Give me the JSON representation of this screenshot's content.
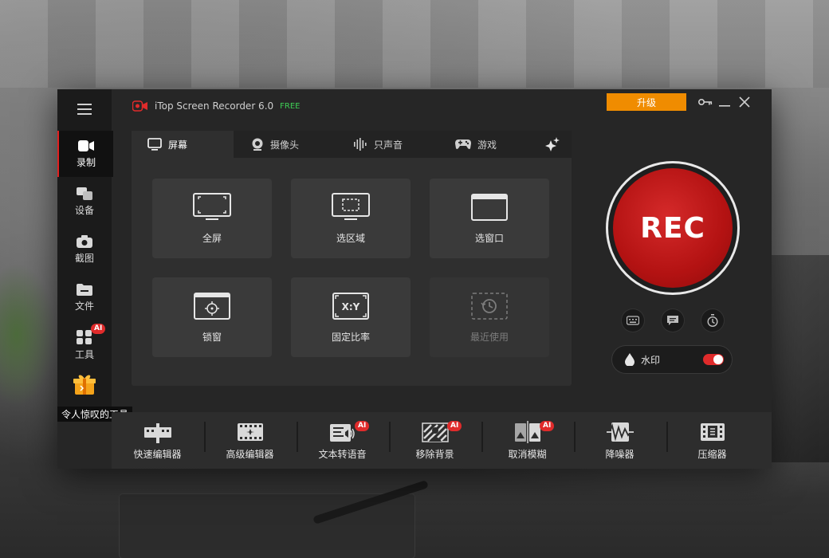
{
  "app": {
    "title": "iTop Screen Recorder 6.0",
    "edition": "FREE",
    "upgrade_label": "升级",
    "accent": "#e02b2b",
    "upgrade_color": "#f08c00"
  },
  "sidebar": {
    "items": [
      {
        "label": "录制",
        "icon": "camera-record-icon",
        "active": true
      },
      {
        "label": "设备",
        "icon": "devices-icon"
      },
      {
        "label": "截图",
        "icon": "screenshot-icon"
      },
      {
        "label": "文件",
        "icon": "folder-icon"
      },
      {
        "label": "工具",
        "icon": "tools-icon",
        "badge": "AI"
      }
    ],
    "gift_icon": "gift-icon",
    "tooltip": "令人惊叹的工具"
  },
  "tabs": [
    {
      "label": "屏幕",
      "icon": "monitor-icon",
      "active": true
    },
    {
      "label": "摄像头",
      "icon": "webcam-icon"
    },
    {
      "label": "只声音",
      "icon": "audio-wave-icon"
    },
    {
      "label": "游戏",
      "icon": "gamepad-icon"
    }
  ],
  "modes": [
    {
      "label": "全屏",
      "icon": "fullscreen-icon"
    },
    {
      "label": "选区域",
      "icon": "select-region-icon"
    },
    {
      "label": "选窗口",
      "icon": "select-window-icon"
    },
    {
      "label": "锁窗",
      "icon": "lock-window-icon"
    },
    {
      "label": "固定比率",
      "icon": "fixed-ratio-icon",
      "inner": "X:Y"
    },
    {
      "label": "最近使用",
      "icon": "recent-icon",
      "disabled": true
    }
  ],
  "rec": {
    "label": "REC"
  },
  "watermark": {
    "label": "水印",
    "enabled": true
  },
  "tools": [
    {
      "label": "快速编辑器",
      "icon": "quick-editor-icon"
    },
    {
      "label": "高级编辑器",
      "icon": "advanced-editor-icon"
    },
    {
      "label": "文本转语音",
      "icon": "text-to-speech-icon",
      "badge": "AI"
    },
    {
      "label": "移除背景",
      "icon": "remove-background-icon",
      "badge": "AI"
    },
    {
      "label": "取消模糊",
      "icon": "unblur-icon",
      "badge": "AI"
    },
    {
      "label": "降噪器",
      "icon": "denoise-icon"
    },
    {
      "label": "压缩器",
      "icon": "compressor-icon"
    }
  ]
}
